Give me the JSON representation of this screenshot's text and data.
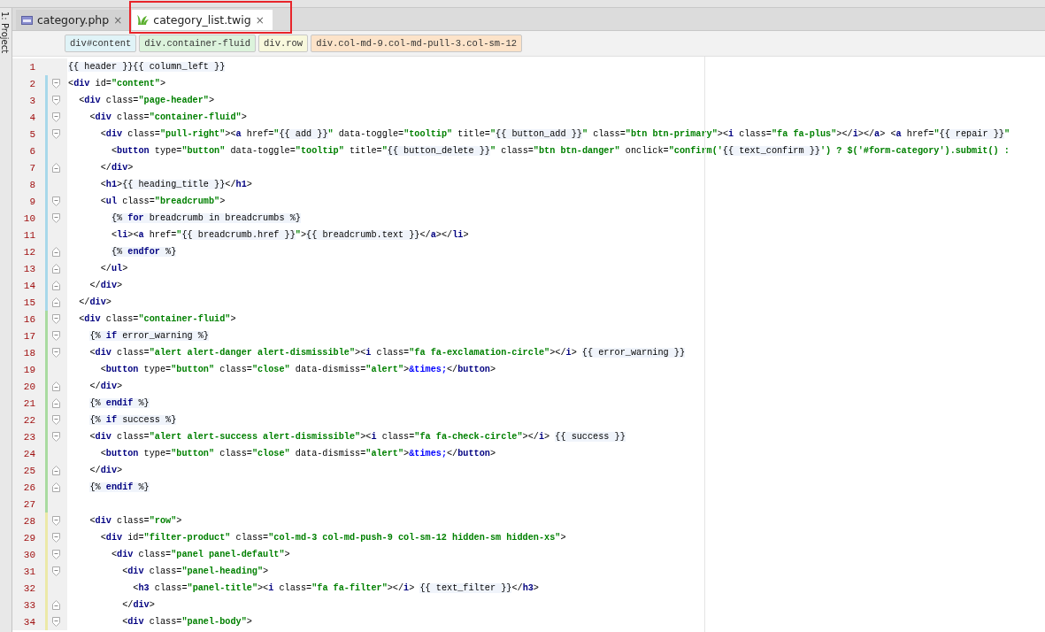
{
  "tool_strip": {
    "label": "1: Project"
  },
  "tabs": [
    {
      "kind": "php",
      "label": "category.php",
      "close": "×",
      "selected": false,
      "highlighted": false
    },
    {
      "kind": "twig",
      "label": "category_list.twig",
      "close": "×",
      "selected": true,
      "highlighted": true
    }
  ],
  "breadcrumbs": [
    {
      "label": "div#content",
      "color": "#e0f3f7"
    },
    {
      "label": "div.container-fluid",
      "color": "#dcf3dc"
    },
    {
      "label": "div.row",
      "color": "#f8f8dc"
    },
    {
      "label": "div.col-md-9.col-md-pull-3.col-sm-12",
      "color": "#fce3c9"
    }
  ],
  "lines": [
    {
      "number": "1",
      "code": "{{ header }}{{ column_left }}",
      "fold_start": false,
      "fold_end": false
    },
    {
      "number": "2",
      "code": "<div id=\"content\">",
      "fold_start": true,
      "fold_end": false,
      "color": "#a8d8ea"
    },
    {
      "number": "3",
      "code": "  <div class=\"page-header\">",
      "fold_start": true,
      "fold_end": false,
      "color": "#a8d8ea"
    },
    {
      "number": "4",
      "code": "    <div class=\"container-fluid\">",
      "fold_start": true,
      "fold_end": false,
      "color": "#a8d8ea"
    },
    {
      "number": "5",
      "code": "      <div class=\"pull-right\"><a href=\"{{ add }}\" data-toggle=\"tooltip\" title=\"{{ button_add }}\" class=\"btn btn-primary\"><i class=\"fa fa-plus\"></i></a> <a href=\"{{ repair }}\"",
      "fold_start": true,
      "fold_end": false,
      "color": "#a8d8ea"
    },
    {
      "number": "6",
      "code": "        <button type=\"button\" data-toggle=\"tooltip\" title=\"{{ button_delete }}\" class=\"btn btn-danger\" onclick=\"confirm('{{ text_confirm }}') ? $('#form-category').submit() :",
      "fold_start": false,
      "fold_end": false,
      "color": "#a8d8ea"
    },
    {
      "number": "7",
      "code": "      </div>",
      "fold_start": false,
      "fold_end": true,
      "color": "#a8d8ea"
    },
    {
      "number": "8",
      "code": "      <h1>{{ heading_title }}</h1>",
      "fold_start": false,
      "fold_end": false,
      "color": "#a8d8ea"
    },
    {
      "number": "9",
      "code": "      <ul class=\"breadcrumb\">",
      "fold_start": true,
      "fold_end": false,
      "color": "#a8d8ea"
    },
    {
      "number": "10",
      "code": "        {% for breadcrumb in breadcrumbs %}",
      "fold_start": true,
      "fold_end": false,
      "color": "#a8d8ea"
    },
    {
      "number": "11",
      "code": "        <li><a href=\"{{ breadcrumb.href }}\">{{ breadcrumb.text }}</a></li>",
      "fold_start": false,
      "fold_end": false,
      "color": "#a8d8ea"
    },
    {
      "number": "12",
      "code": "        {% endfor %}",
      "fold_start": false,
      "fold_end": true,
      "color": "#a8d8ea"
    },
    {
      "number": "13",
      "code": "      </ul>",
      "fold_start": false,
      "fold_end": true,
      "color": "#a8d8ea"
    },
    {
      "number": "14",
      "code": "    </div>",
      "fold_start": false,
      "fold_end": true,
      "color": "#a8d8ea"
    },
    {
      "number": "15",
      "code": "  </div>",
      "fold_start": false,
      "fold_end": true,
      "color": "#a8d8ea"
    },
    {
      "number": "16",
      "code": "  <div class=\"container-fluid\">",
      "fold_start": true,
      "fold_end": false,
      "color": "#a9dba0"
    },
    {
      "number": "17",
      "code": "    {% if error_warning %}",
      "fold_start": true,
      "fold_end": false,
      "color": "#a9dba0"
    },
    {
      "number": "18",
      "code": "    <div class=\"alert alert-danger alert-dismissible\"><i class=\"fa fa-exclamation-circle\"></i> {{ error_warning }}",
      "fold_start": true,
      "fold_end": false,
      "color": "#a9dba0"
    },
    {
      "number": "19",
      "code": "      <button type=\"button\" class=\"close\" data-dismiss=\"alert\">&times;</button>",
      "fold_start": false,
      "fold_end": false,
      "color": "#a9dba0"
    },
    {
      "number": "20",
      "code": "    </div>",
      "fold_start": false,
      "fold_end": true,
      "color": "#a9dba0"
    },
    {
      "number": "21",
      "code": "    {% endif %}",
      "fold_start": false,
      "fold_end": true,
      "color": "#a9dba0"
    },
    {
      "number": "22",
      "code": "    {% if success %}",
      "fold_start": true,
      "fold_end": false,
      "color": "#a9dba0"
    },
    {
      "number": "23",
      "code": "    <div class=\"alert alert-success alert-dismissible\"><i class=\"fa fa-check-circle\"></i> {{ success }}",
      "fold_start": true,
      "fold_end": false,
      "color": "#a9dba0"
    },
    {
      "number": "24",
      "code": "      <button type=\"button\" class=\"close\" data-dismiss=\"alert\">&times;</button>",
      "fold_start": false,
      "fold_end": false,
      "color": "#a9dba0"
    },
    {
      "number": "25",
      "code": "    </div>",
      "fold_start": false,
      "fold_end": true,
      "color": "#a9dba0"
    },
    {
      "number": "26",
      "code": "    {% endif %}",
      "fold_start": false,
      "fold_end": true,
      "color": "#a9dba0"
    },
    {
      "number": "27",
      "fold_start": false,
      "fold_end": false,
      "color": "#a9dba0"
    },
    {
      "number": "28",
      "code": "    <div class=\"row\">",
      "fold_start": true,
      "fold_end": false,
      "color": "#ece9a8"
    },
    {
      "number": "29",
      "code": "      <div id=\"filter-product\" class=\"col-md-3 col-md-push-9 col-sm-12 hidden-sm hidden-xs\">",
      "fold_start": true,
      "fold_end": false,
      "color": "#ece9a8"
    },
    {
      "number": "30",
      "code": "        <div class=\"panel panel-default\">",
      "fold_start": true,
      "fold_end": false,
      "color": "#ece9a8"
    },
    {
      "number": "31",
      "code": "          <div class=\"panel-heading\">",
      "fold_start": true,
      "fold_end": false,
      "color": "#ece9a8"
    },
    {
      "number": "32",
      "code": "            <h3 class=\"panel-title\"><i class=\"fa fa-filter\"></i> {{ text_filter }}</h3>",
      "fold_start": false,
      "fold_end": false,
      "color": "#ece9a8"
    },
    {
      "number": "33",
      "code": "          </div>",
      "fold_start": false,
      "fold_end": true,
      "color": "#ece9a8"
    },
    {
      "number": "34",
      "code": "          <div class=\"panel-body\">",
      "fold_start": true,
      "fold_end": false,
      "color": "#ece9a8"
    }
  ]
}
